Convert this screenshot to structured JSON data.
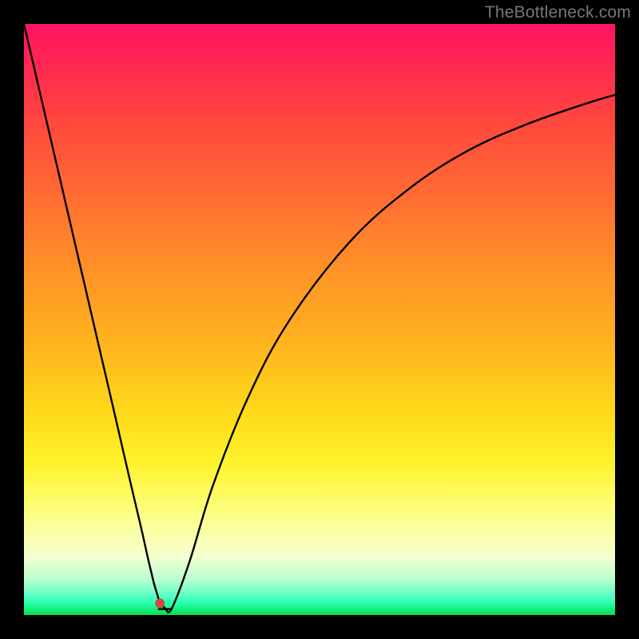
{
  "watermark": "TheBottleneck.com",
  "chart_data": {
    "type": "line",
    "title": "",
    "xlabel": "",
    "ylabel": "",
    "xlim": [
      0,
      100
    ],
    "ylim": [
      0,
      100
    ],
    "grid": false,
    "legend": false,
    "background": "rainbow-gradient",
    "series": [
      {
        "name": "curve",
        "x": [
          0,
          5,
          10,
          15,
          18,
          20,
          21,
          22,
          23,
          24,
          25,
          28,
          32,
          38,
          45,
          55,
          65,
          75,
          85,
          95,
          100
        ],
        "y": [
          100,
          78.5,
          57,
          35.5,
          22.5,
          14,
          9.5,
          5.3,
          2.0,
          1.0,
          1.1,
          9,
          22,
          37,
          50,
          63,
          72,
          78.5,
          83,
          86.5,
          88
        ]
      }
    ],
    "marker": {
      "x": 23,
      "y": 2.0,
      "color": "#cc4a3f",
      "radius_px": 6
    }
  }
}
